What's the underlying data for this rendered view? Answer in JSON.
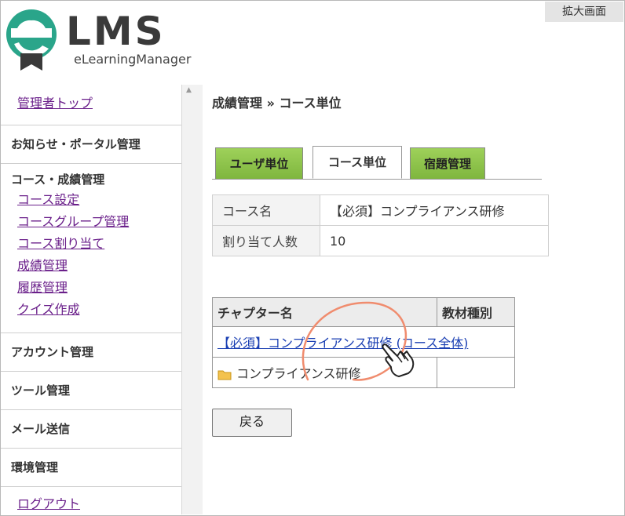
{
  "zoom_label": "拡大画面",
  "logo": {
    "brand": "LMS",
    "subtitle": "eLearningManager",
    "icon": "elms-e-logo-icon"
  },
  "sidebar": {
    "top_link": "管理者トップ",
    "sections": [
      {
        "heading": "お知らせ・ポータル管理"
      },
      {
        "heading": "コース・成績管理",
        "links": [
          "コース設定",
          "コースグループ管理",
          "コース割り当て",
          "成績管理",
          "履歴管理",
          "クイズ作成"
        ]
      },
      {
        "heading": "アカウント管理"
      },
      {
        "heading": "ツール管理"
      },
      {
        "heading": "メール送信"
      },
      {
        "heading": "環境管理"
      }
    ],
    "logout": "ログアウト"
  },
  "breadcrumb": "成績管理 » コース単位",
  "tabs": [
    {
      "label": "ユーザ単位",
      "state": "inactive"
    },
    {
      "label": "コース単位",
      "state": "active"
    },
    {
      "label": "宿題管理",
      "state": "inactive"
    }
  ],
  "info": {
    "course_name_label": "コース名",
    "course_name_value": "【必須】コンプライアンス研修",
    "assigned_label": "割り当て人数",
    "assigned_value": "10"
  },
  "chapter_table": {
    "headers": [
      "チャプター名",
      "教材種別"
    ],
    "course_link": "【必須】コンプライアンス研修 (コース全体)",
    "rows": [
      {
        "name": "コンプライアンス研修",
        "icon": "folder-icon",
        "type": ""
      }
    ]
  },
  "back_button": "戻る",
  "colors": {
    "tab_green": "#8bc34a",
    "link": "#1a3fb3",
    "visited_link": "#6a1f8a",
    "annotation": "#f08c6e"
  }
}
